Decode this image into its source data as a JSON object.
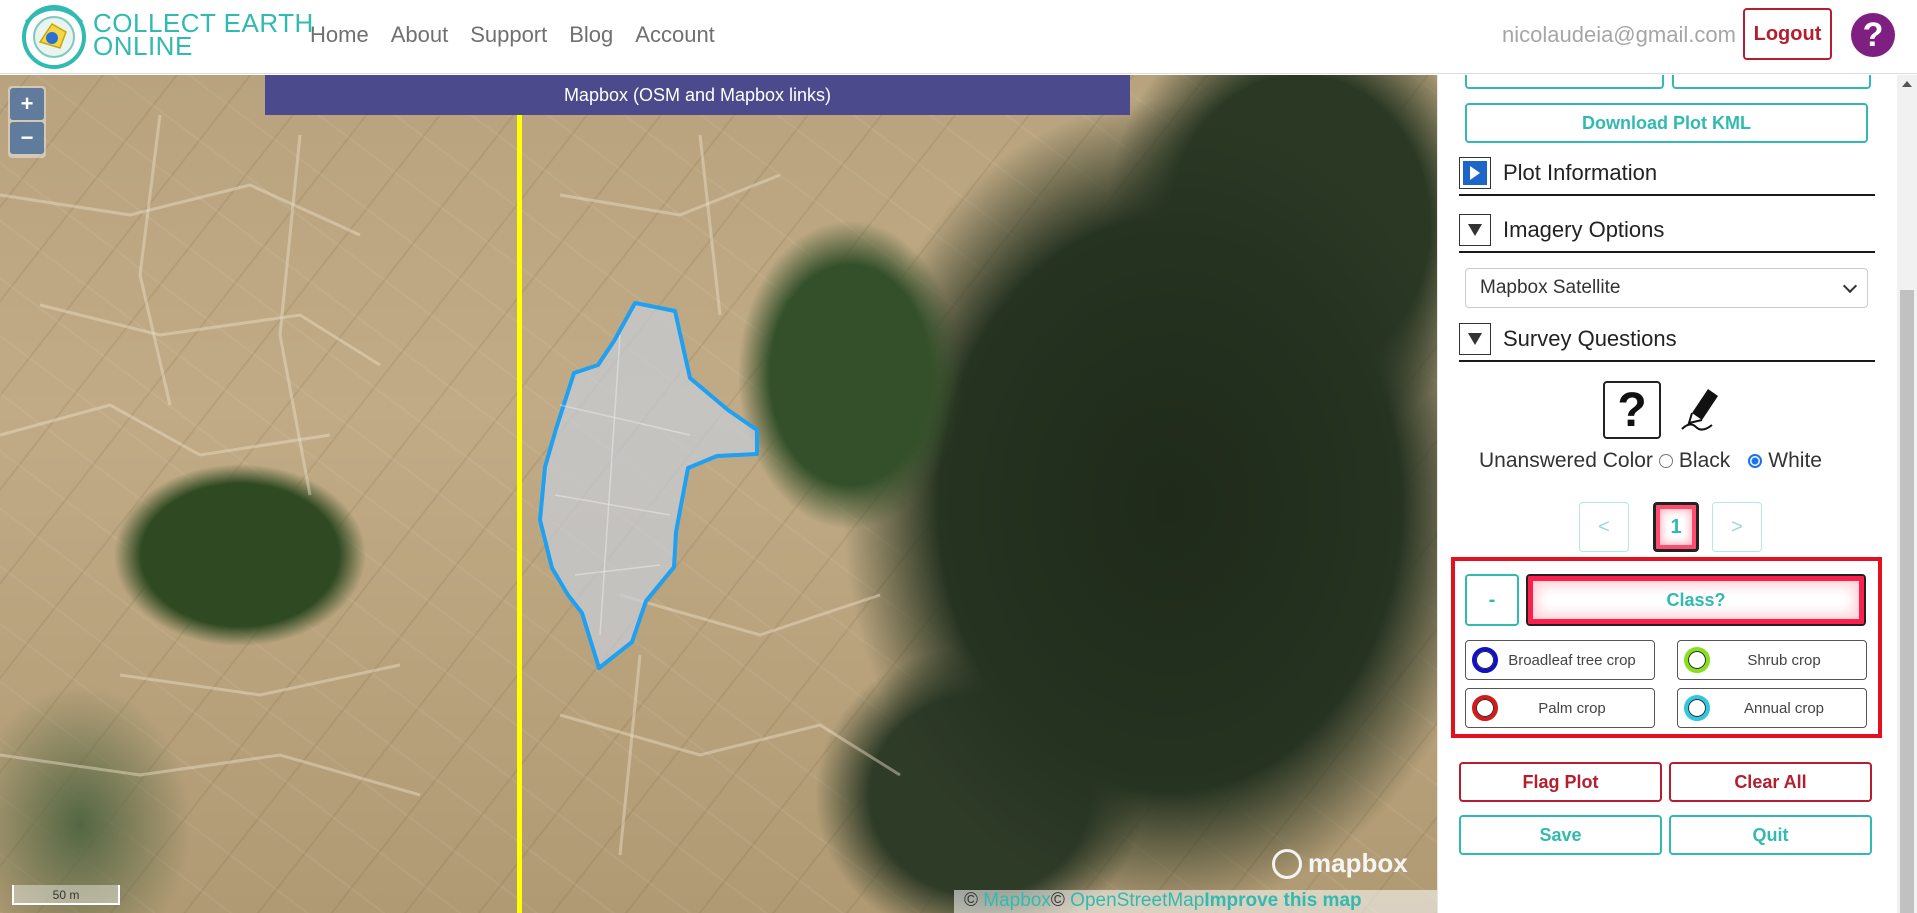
{
  "header": {
    "logo_text_line1": "COLLECT EARTH",
    "logo_text_line2": "ONLINE",
    "nav": [
      "Home",
      "About",
      "Support",
      "Blog",
      "Account"
    ],
    "user_email": "nicolaudeia@gmail.com",
    "logout_label": "Logout",
    "help_label": "?"
  },
  "map": {
    "imagery_banner": "Mapbox (OSM and Mapbox links)",
    "zoom_in": "+",
    "zoom_out": "−",
    "scale_label": "50 m",
    "mapbox_logo": "mapbox",
    "attribution": {
      "copy1": "© ",
      "mapbox": "Mapbox",
      "copy2": "© ",
      "osm": "OpenStreetMap",
      "improve": "Improve this map"
    }
  },
  "sidebar": {
    "download_kml": "Download Plot KML",
    "plot_information": "Plot Information",
    "imagery_options": "Imagery Options",
    "imagery_select": "Mapbox Satellite",
    "survey_questions": "Survey Questions",
    "question_icon": "?",
    "unanswered_color_label": "Unanswered Color",
    "color_black": "Black",
    "color_white": "White",
    "color_selected": "White",
    "pagination": {
      "prev": "<",
      "current": "1",
      "next": ">"
    },
    "minus_label": "-",
    "question_label": "Class?",
    "answers": [
      {
        "label": "Broadleaf tree crop",
        "color": "#1010c8"
      },
      {
        "label": "Shrub crop",
        "color": "#86e01a"
      },
      {
        "label": "Palm crop",
        "color": "#d41a1a"
      },
      {
        "label": "Annual crop",
        "color": "#2ec8e0"
      }
    ],
    "flag_plot": "Flag Plot",
    "clear_all": "Clear All",
    "save": "Save",
    "quit": "Quit"
  },
  "colors": {
    "accent_teal": "#31bab0",
    "danger_red": "#b41e2e",
    "banner_purple": "#4b4a8c",
    "help_purple": "#7e1f81",
    "highlight_red": "#e1111f",
    "plot_outline": "#1fa0f0",
    "sample_line": "#ffff00"
  }
}
